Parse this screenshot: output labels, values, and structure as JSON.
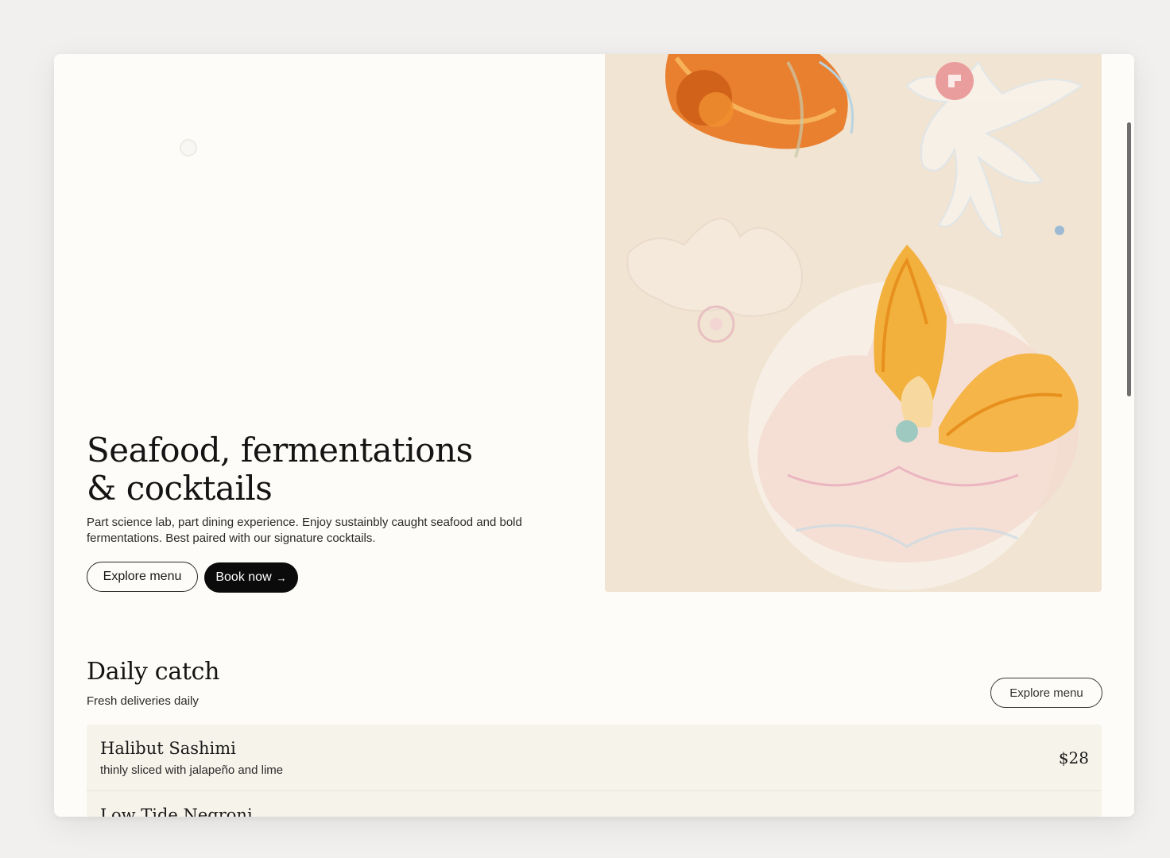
{
  "hero": {
    "title_line1": "Seafood, fermentations",
    "title_line2": "& cocktails",
    "description": "Part science lab, part dining experience. Enjoy sustainbly caught seafood and bold fermentations. Best paired with our signature cocktails.",
    "explore_label": "Explore menu",
    "book_label": "Book now",
    "book_icon": "arrow-right-icon",
    "image_icon": "jellyfish-illustration"
  },
  "daily_catch": {
    "title": "Daily catch",
    "subtitle": "Fresh deliveries daily",
    "explore_label": "Explore menu",
    "items": [
      {
        "name": "Halibut Sashimi",
        "description": "thinly sliced with jalapeño and lime",
        "price": "$28"
      },
      {
        "name": "Low Tide Negroni",
        "description": "",
        "price": ""
      }
    ]
  },
  "colors": {
    "page_background": "#fdfcf8",
    "primary_button": "#0b0b0b",
    "menu_row": "#f6f3ea",
    "art_background": "#f1e4d2",
    "accent_orange": "#e8741e",
    "accent_yellow": "#f2b13c"
  }
}
